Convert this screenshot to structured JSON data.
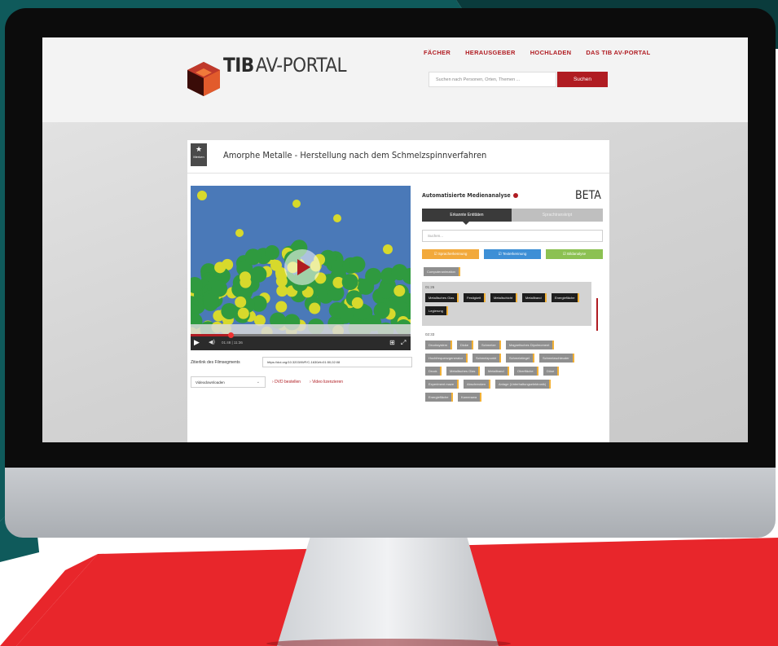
{
  "site": {
    "logo_bold": "TIB",
    "logo_rest": "AV-PORTAL",
    "nav": [
      "FÄCHER",
      "HERAUSGEBER",
      "HOCHLADEN",
      "DAS TIB AV-PORTAL"
    ],
    "search_placeholder": "Suchen nach Personen, Orten, Themen ...",
    "search_button": "Suchen",
    "accent_color": "#b01c22"
  },
  "video": {
    "merken_label": "Merken",
    "title": "Amorphe Metalle - Herstellung nach dem Schmelzspinnverfahren",
    "time": "01:48 | 11:36",
    "progress_fraction": 0.18,
    "cite_label": "Zitierlink des Filmsegments",
    "cite_link": "https://doi.org/10.3203/IWF/C-1630#t=01:50,02:08",
    "download_select": "Videodownloaden",
    "order_dvd": "DVD bestellen",
    "license": "Video lizenzieren"
  },
  "analysis": {
    "title": "Automatisierte Medienanalyse",
    "beta": "BETA",
    "tabs": [
      "Erkannte Entitäten",
      "Sprachtranskript"
    ],
    "search_placeholder": "Suchen...",
    "filters": [
      "Spracherkennung",
      "Texterkennung",
      "Bildanalyse"
    ],
    "filter_colors": [
      "#f2a93b",
      "#3d8fd6",
      "#8cc152"
    ],
    "first_tag": "Computeranimation",
    "groups": [
      {
        "timestamp": "01:26",
        "tags": [
          "Metallisches Glas",
          "Festigkeit",
          "Metallschicht",
          "Metallband",
          "Energiefläche",
          "Legierung"
        ]
      },
      {
        "timestamp": "02:33",
        "tags": [
          "Drucksystem",
          "Dicke",
          "Schmelze",
          "Magnetisches Dipolmoment",
          "Hochfrequenzgenerator",
          "Schmelzpunkt",
          "Schmelztiegel",
          "Schmelzschleuder",
          "Druck",
          "Metallisches Glas",
          "Metallband",
          "Oberfläche",
          "Düse",
          "Experiment maze",
          "Abschrecken",
          "Anlage (Unterhaltungselektronik)",
          "Energiefläche",
          "Kamerawa"
        ]
      }
    ]
  }
}
